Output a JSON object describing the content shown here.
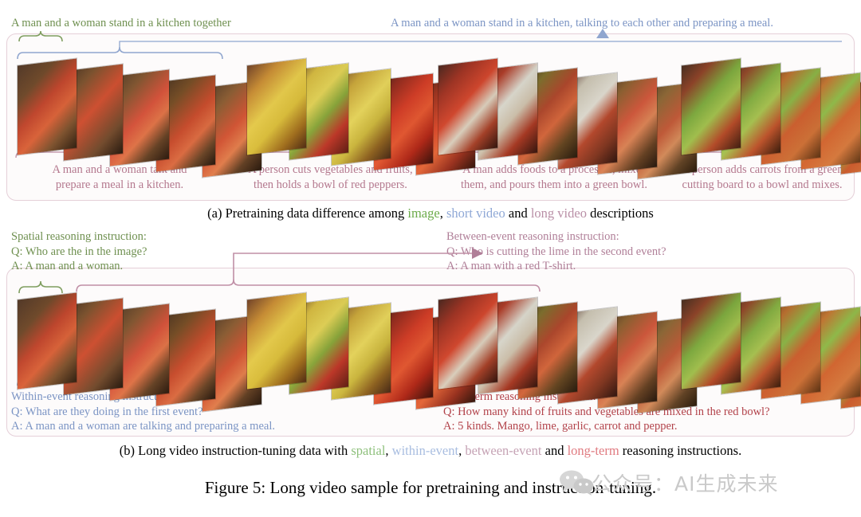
{
  "figure": {
    "title_prefix": "Figure 5: ",
    "title": "Figure 5: Long video sample for pretraining and instruction-tuning."
  },
  "panel_a": {
    "top_left_caption": "A man and a woman stand in a kitchen together",
    "top_right_caption": "A man and a woman stand in a kitchen, talking to each other and preparing a meal.",
    "event_captions": [
      "A man and a woman talk and\nprepare a meal in a kitchen.",
      "A person cuts vegetables and fruits,\nthen holds a bowl of red peppers.",
      "A man adds foods to a processor, mixes\nthem, and pours them into a green bowl.",
      "A person adds carrots from a green\ncutting board to a bowl and mixes."
    ],
    "caption_parts": {
      "p1": "(a) Pretraining data difference among ",
      "kw1": "image",
      "p2": ", ",
      "kw2": "short video",
      "p3": " and ",
      "kw3": "long video",
      "p4": " descriptions"
    }
  },
  "panel_b": {
    "spatial": {
      "heading": "Spatial reasoning instruction:",
      "q": "Q: Who are the in the image?",
      "a": "A: A man and a woman."
    },
    "between_event": {
      "heading": "Between-event reasoning instruction:",
      "q": "Q: Who is cutting the lime in the second event?",
      "a": "A: A man with a red T-shirt."
    },
    "within_event": {
      "heading": "Within-event reasoning instruction:",
      "q": "Q: What are they doing in the first event?",
      "a": "A: A man and a woman are talking and preparing a meal."
    },
    "long_term": {
      "heading": "Long-term reasoning instruction:",
      "q": "Q:  How many kind of fruits and vegetables are mixed in the red bowl?",
      "a": "A: 5 kinds. Mango, lime, garlic, carrot and pepper."
    },
    "caption_parts": {
      "p1": "(b) Long video instruction-tuning data with ",
      "kw1": "spatial",
      "p2": ", ",
      "kw2": "within-event",
      "p3": ", ",
      "kw3": "between-event",
      "p4": " and ",
      "kw4": "long-term",
      "p5": " reasoning instructions."
    }
  },
  "watermark": {
    "text": "公众号：AI生成未来"
  },
  "colors": {
    "pink_caption": "#b4788e",
    "green": "#6f9050",
    "blue": "#7b94c4",
    "mauve": "#b07f98",
    "red": "#b2424a",
    "panel_border": "#e5cfd8"
  },
  "strips": {
    "a": [
      {
        "name": "event-1",
        "frames": 5
      },
      {
        "name": "event-2",
        "frames": 5
      },
      {
        "name": "event-3",
        "frames": 6
      },
      {
        "name": "event-4",
        "frames": 5
      }
    ],
    "b": [
      {
        "name": "event-1",
        "frames": 5
      },
      {
        "name": "event-2",
        "frames": 5
      },
      {
        "name": "event-3",
        "frames": 6
      },
      {
        "name": "event-4",
        "frames": 5
      }
    ]
  }
}
